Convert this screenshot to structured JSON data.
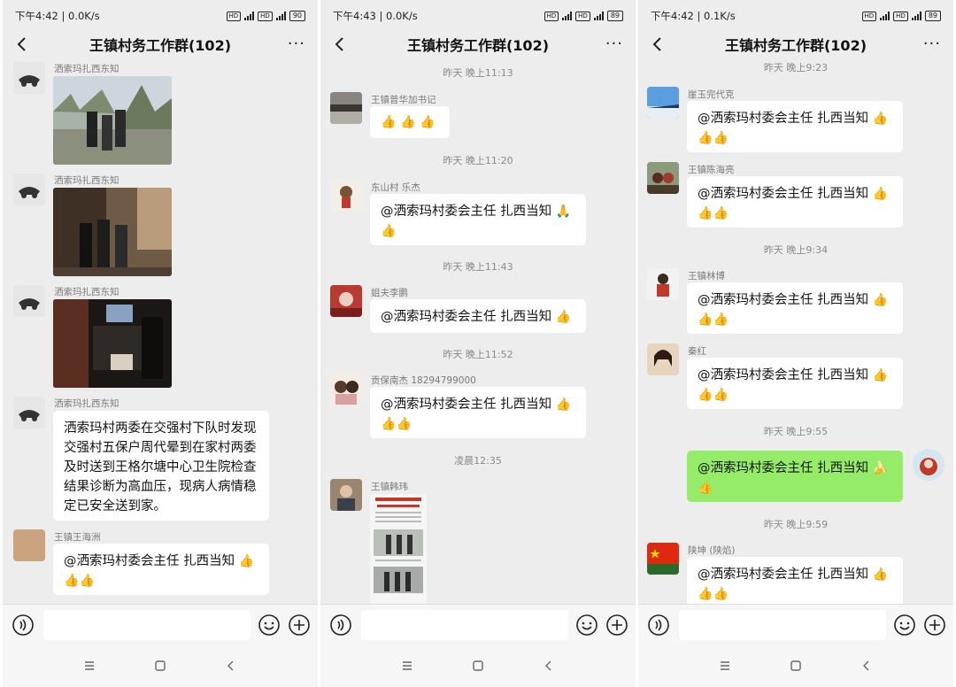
{
  "group_title": "王镇村务工作群(102)",
  "more_label": "···",
  "panels": [
    {
      "status_time": "下午4:42 | 0.0K/s",
      "battery": "90",
      "bubbles": [
        {
          "name": "洒索玛扎西东知",
          "text": "洒索玛村两委在交强村下队时发现交强村五保户周代晕到在家村两委及时送到王格尔塘中心卫生院检查  结果诊断为高血压，现病人病情稳定已安全送到家。"
        },
        {
          "name": "王镇王海洲",
          "text": "@洒索玛村委会主任 扎西当知"
        }
      ],
      "photo_names": [
        "洒索玛扎西东知",
        "洒索玛扎西东知",
        "洒索玛扎西东知"
      ]
    },
    {
      "status_time": "下午4:43 | 0.0K/s",
      "battery": "89",
      "times": [
        "昨天 晚上11:13",
        "昨天 晚上11:20",
        "昨天 晚上11:43",
        "昨天 晚上11:52",
        "凌晨12:35"
      ],
      "names": [
        "王镇普华加书记",
        "东山村  乐杰",
        "姐夫李鹏",
        "贡保南杰 18294799000",
        "王镇韩玮"
      ],
      "mention": "@洒索玛村委会主任 扎西当知"
    },
    {
      "status_time": "下午4:42 | 0.1K/s",
      "battery": "89",
      "times": [
        "昨天 晚上9:23",
        "昨天 晚上9:34",
        "昨天 晚上9:55",
        "昨天 晚上9:59"
      ],
      "names": [
        "崖玉完代克",
        "王镇陈海亮",
        "王镇林博",
        "秦红",
        "陕坤 (陕焰)"
      ],
      "mention": "@洒索玛村委会主任 扎西当知"
    }
  ],
  "icons": {
    "thumbs": "👍",
    "pray": "🙏",
    "banana": "🍌"
  }
}
